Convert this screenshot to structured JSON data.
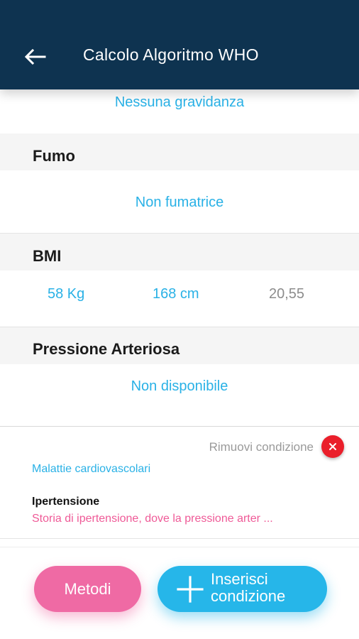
{
  "appbar": {
    "title": "Calcolo Algoritmo WHO",
    "back_icon": "arrow-left-icon"
  },
  "pregnancy": {
    "value": "Nessuna gravidanza"
  },
  "smoking": {
    "heading": "Fumo",
    "value": "Non fumatrice"
  },
  "bmi": {
    "heading": "BMI",
    "weight": "58 Kg",
    "height": "168 cm",
    "index": "20,55"
  },
  "blood_pressure": {
    "heading": "Pressione Arteriosa",
    "value": "Non disponibile"
  },
  "condition": {
    "remove_label": "Rimuovi condizione",
    "remove_icon": "close-icon",
    "category": "Malattie cardiovascolari",
    "name": "Ipertensione",
    "description": "Storia di ipertensione, dove la pressione arter ..."
  },
  "actions": {
    "methods_label": "Metodi",
    "add_line1": "Inserisci",
    "add_line2": "condizione",
    "add_icon": "plus-icon"
  },
  "colors": {
    "appbar": "#0e3350",
    "accent_blue": "#29b1e6",
    "accent_pink": "#ef6aa4",
    "danger": "#ea1f2b"
  }
}
